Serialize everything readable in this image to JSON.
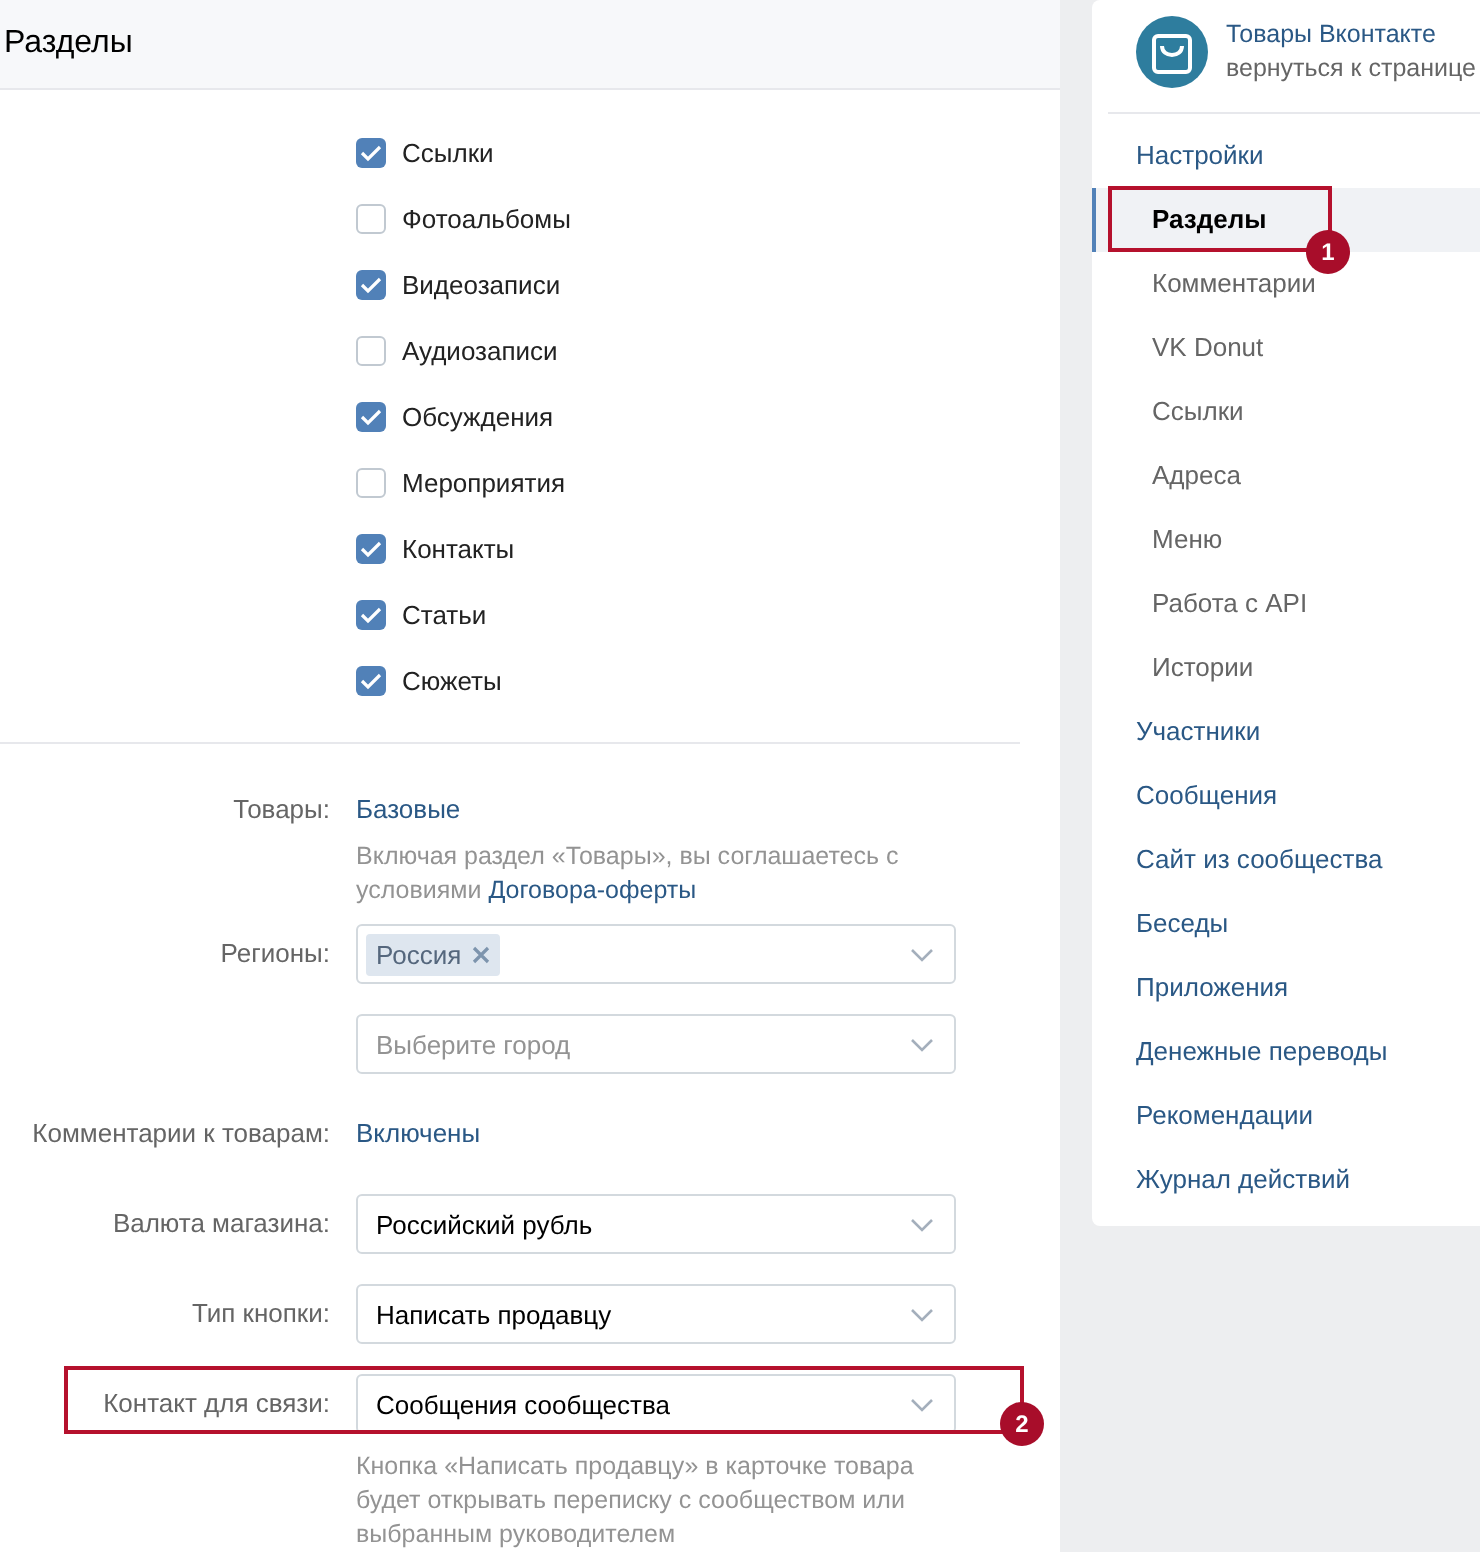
{
  "header": {
    "title": "Разделы"
  },
  "sections": [
    {
      "label": "Ссылки",
      "checked": true
    },
    {
      "label": "Фотоальбомы",
      "checked": false
    },
    {
      "label": "Видеозаписи",
      "checked": true
    },
    {
      "label": "Аудиозаписи",
      "checked": false
    },
    {
      "label": "Обсуждения",
      "checked": true
    },
    {
      "label": "Мероприятия",
      "checked": false
    },
    {
      "label": "Контакты",
      "checked": true
    },
    {
      "label": "Статьи",
      "checked": true
    },
    {
      "label": "Сюжеты",
      "checked": true
    }
  ],
  "form": [
    {
      "kind": "link",
      "label": "Товары:",
      "value": "Базовые",
      "note": "Включая раздел «Товары», вы соглашаетесь с условиями",
      "note_link": "Договора-оферты"
    },
    {
      "kind": "tags",
      "label": "Регионы:",
      "tags": [
        "Россия"
      ]
    },
    {
      "kind": "select",
      "placeholder": "Выберите город"
    },
    {
      "kind": "link",
      "label": "Комментарии к товарам:",
      "value": "Включены"
    },
    {
      "kind": "select",
      "label": "Валюта магазина:",
      "value": "Российский рубль"
    },
    {
      "kind": "select",
      "label": "Тип кнопки:",
      "value": "Написать продавцу"
    },
    {
      "kind": "select",
      "label": "Контакт для связи:",
      "value": "Сообщения сообщества",
      "annotation": "2",
      "note": "Кнопка «Написать продавцу» в карточке товара будет открывать переписку с сообществом или выбранным руководителем"
    }
  ],
  "sidebar": {
    "title": "Товары Вконтакте",
    "subtitle": "вернуться к странице",
    "items": [
      {
        "label": "Настройки",
        "selected": false,
        "children": [
          {
            "label": "Разделы",
            "selected": true,
            "annotation": "1"
          },
          {
            "label": "Комментарии",
            "selected": false
          },
          {
            "label": "VK Donut",
            "selected": false
          },
          {
            "label": "Ссылки",
            "selected": false
          },
          {
            "label": "Адреса",
            "selected": false
          },
          {
            "label": "Меню",
            "selected": false
          },
          {
            "label": "Работа с API",
            "selected": false
          },
          {
            "label": "Истории",
            "selected": false
          }
        ]
      },
      {
        "label": "Участники",
        "selected": false
      },
      {
        "label": "Сообщения",
        "selected": false
      },
      {
        "label": "Сайт из сообщества",
        "selected": false
      },
      {
        "label": "Беседы",
        "selected": false
      },
      {
        "label": "Приложения",
        "selected": false
      },
      {
        "label": "Денежные переводы",
        "selected": false
      },
      {
        "label": "Рекомендации",
        "selected": false
      },
      {
        "label": "Журнал действий",
        "selected": false
      }
    ]
  }
}
